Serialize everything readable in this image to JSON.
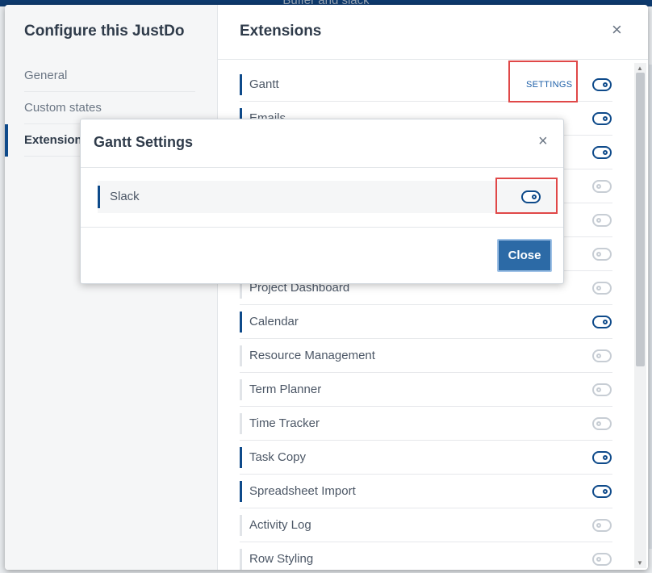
{
  "background": {
    "title": "Buffer and slack"
  },
  "modal": {
    "title": "Configure this JustDo",
    "close_glyph": "×",
    "sidebar": {
      "items": [
        {
          "label": "General",
          "active": false
        },
        {
          "label": "Custom states",
          "active": false
        },
        {
          "label": "Extensions",
          "active": true
        }
      ]
    },
    "content_title": "Extensions",
    "extensions": [
      {
        "name": "Gantt",
        "enabled": true,
        "settings_label": "SETTINGS"
      },
      {
        "name": "Emails",
        "enabled": true
      },
      {
        "name": "",
        "enabled": true
      },
      {
        "name": "",
        "enabled": false
      },
      {
        "name": "",
        "enabled": false
      },
      {
        "name": "",
        "enabled": false
      },
      {
        "name": "Project Dashboard",
        "enabled": false
      },
      {
        "name": "Calendar",
        "enabled": true
      },
      {
        "name": "Resource Management",
        "enabled": false
      },
      {
        "name": "Term Planner",
        "enabled": false
      },
      {
        "name": "Time Tracker",
        "enabled": false
      },
      {
        "name": "Task Copy",
        "enabled": true
      },
      {
        "name": "Spreadsheet Import",
        "enabled": true
      },
      {
        "name": "Activity Log",
        "enabled": false
      },
      {
        "name": "Row Styling",
        "enabled": false
      }
    ]
  },
  "sub_modal": {
    "title": "Gantt Settings",
    "close_glyph": "×",
    "row_label": "Slack",
    "row_enabled": true,
    "close_button": "Close"
  },
  "icons": {
    "close": "close-icon",
    "toggle": "toggle-switch-icon"
  },
  "colors": {
    "accent": "#0e4a8a",
    "primary_button": "#2c6aa6",
    "highlight": "#e04848"
  }
}
